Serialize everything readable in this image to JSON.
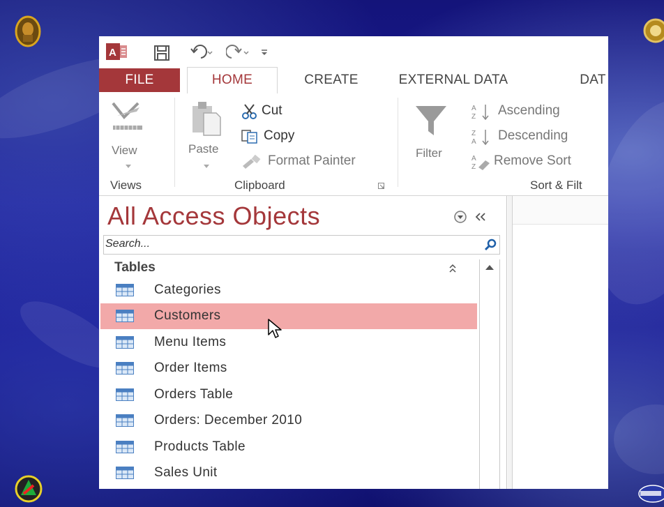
{
  "ribbon_tabs": {
    "file": "FILE",
    "home": "HOME",
    "create": "CREATE",
    "external_data": "EXTERNAL DATA",
    "database_tools": "DAT"
  },
  "views_group": {
    "view_label": "View",
    "group_label": "Views"
  },
  "clipboard_group": {
    "paste_label": "Paste",
    "cut_label": "Cut",
    "copy_label": "Copy",
    "format_painter_label": "Format Painter",
    "group_label": "Clipboard"
  },
  "sort_filter_group": {
    "filter_label": "Filter",
    "ascending_label": "Ascending",
    "descending_label": "Descending",
    "remove_sort_label": "Remove Sort",
    "group_label": "Sort & Filt"
  },
  "nav_pane": {
    "title": "All Access Objects",
    "search_placeholder": "Search...",
    "section_title": "Tables",
    "items": [
      {
        "label": "Categories",
        "selected": false
      },
      {
        "label": "Customers",
        "selected": true
      },
      {
        "label": "Menu Items",
        "selected": false
      },
      {
        "label": "Order Items",
        "selected": false
      },
      {
        "label": "Orders Table",
        "selected": false
      },
      {
        "label": "Orders: December 2010",
        "selected": false
      },
      {
        "label": "Products Table",
        "selected": false
      },
      {
        "label": "Sales Unit",
        "selected": false
      }
    ]
  },
  "colors": {
    "access_red": "#a4373a",
    "selection": "#f2a9a9",
    "background": "#1b1b9c"
  },
  "icons": {
    "access_logo": "access-logo-icon",
    "save": "save-icon",
    "undo": "undo-icon",
    "redo": "redo-icon",
    "customize": "customize-qat-icon",
    "cut": "scissors-icon",
    "copy": "copy-icon",
    "format_painter": "paintbrush-icon",
    "filter": "funnel-icon",
    "search": "search-icon",
    "table": "table-icon"
  }
}
